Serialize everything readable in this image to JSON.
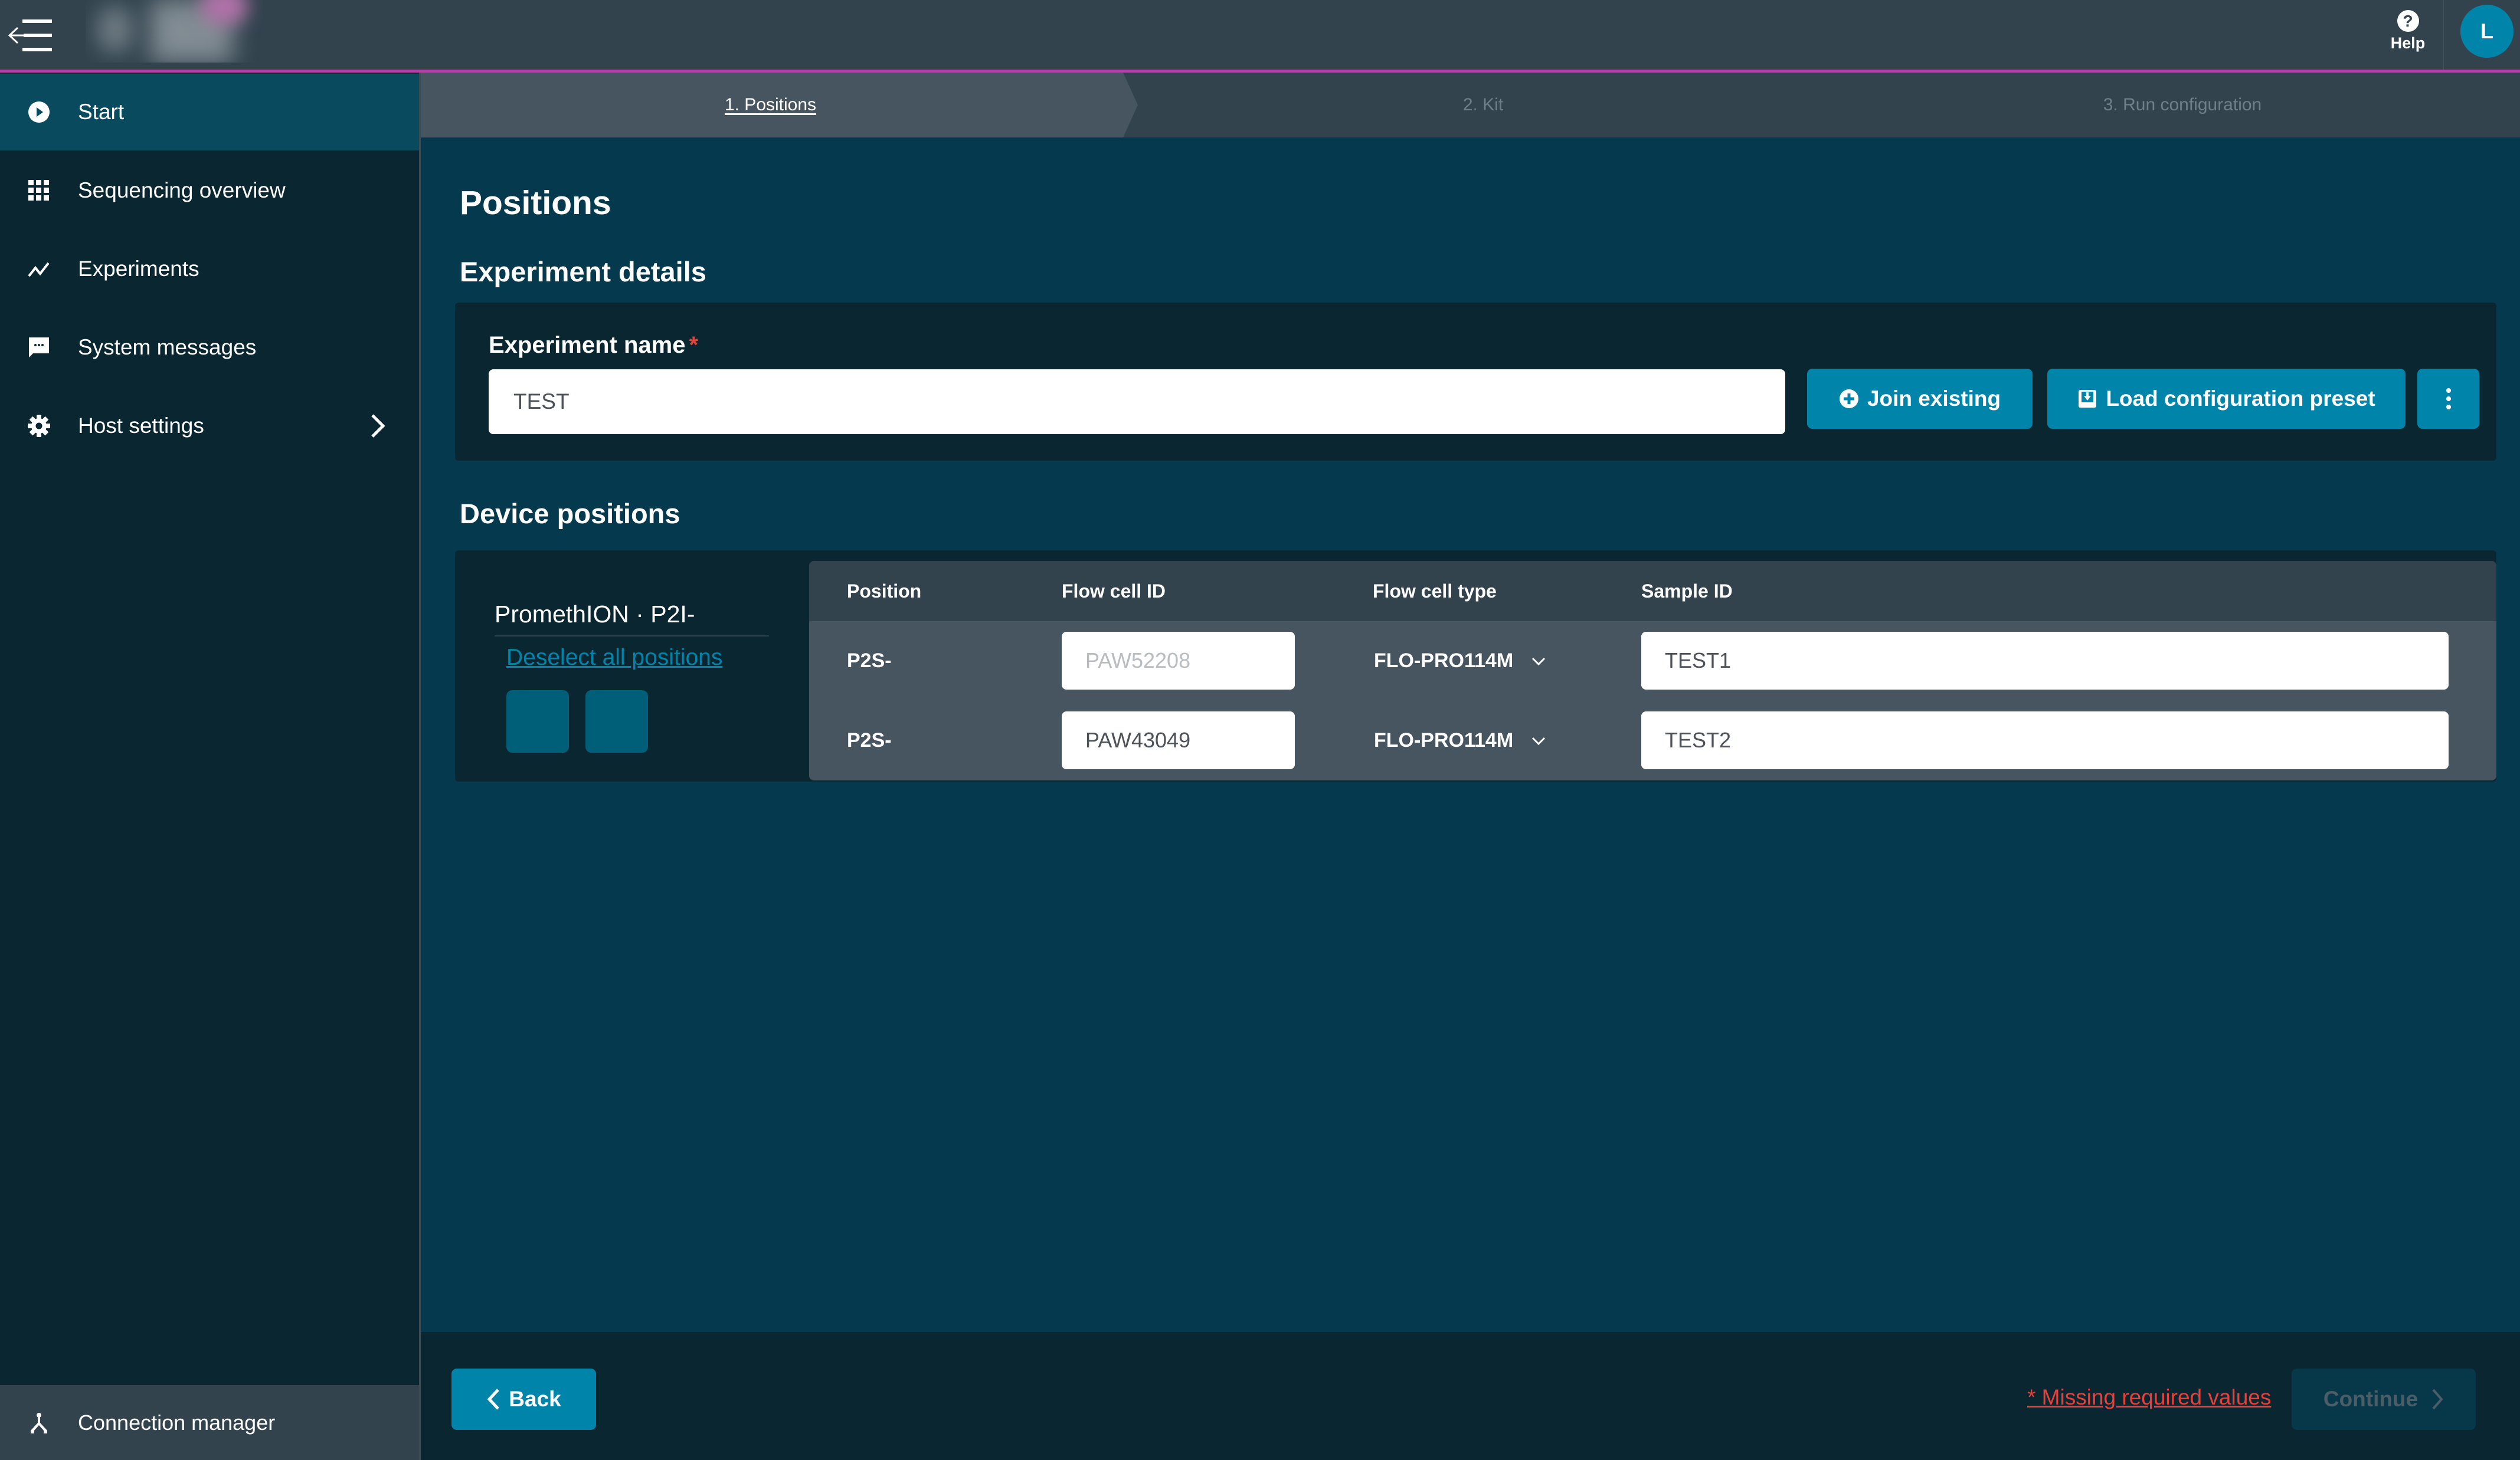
{
  "topbar": {
    "help_label": "Help",
    "help_glyph": "?",
    "avatar_initial": "L",
    "accent_line_color": "#b542a6"
  },
  "sidebar": {
    "items": [
      {
        "label": "Start",
        "icon": "play-circle-icon",
        "active": true
      },
      {
        "label": "Sequencing overview",
        "icon": "grid-icon"
      },
      {
        "label": "Experiments",
        "icon": "trend-line-icon"
      },
      {
        "label": "System messages",
        "icon": "chat-bubble-icon"
      },
      {
        "label": "Host settings",
        "icon": "gear-icon",
        "has_submenu": true
      }
    ],
    "bottom_item": {
      "label": "Connection manager",
      "icon": "network-icon"
    }
  },
  "stepper": {
    "steps": [
      {
        "label": "1. Positions",
        "active": true
      },
      {
        "label": "2. Kit",
        "active": false
      },
      {
        "label": "3. Run configuration",
        "active": false
      }
    ]
  },
  "main": {
    "page_title": "Positions",
    "experiment_details": {
      "title": "Experiment details",
      "name_label": "Experiment name",
      "required_marker": "*",
      "name_value": "TEST",
      "join_existing_label": "Join existing",
      "load_preset_label": "Load configuration preset",
      "more_options_glyph": "⋮"
    },
    "device_positions": {
      "title": "Device positions",
      "device_name": "PromethION · P2I-",
      "deselect_all_label": "Deselect all positions",
      "position_tiles": 2,
      "table": {
        "headers": [
          "Position",
          "Flow cell ID",
          "Flow cell type",
          "Sample ID"
        ],
        "rows": [
          {
            "position": "P2S-",
            "flow_cell_id": "",
            "flow_cell_id_placeholder": "PAW52208",
            "flow_cell_type": "FLO-PRO114M",
            "sample_id": "TEST1"
          },
          {
            "position": "P2S-",
            "flow_cell_id": "PAW43049",
            "flow_cell_id_placeholder": "",
            "flow_cell_type": "FLO-PRO114M",
            "sample_id": "TEST2"
          }
        ]
      }
    }
  },
  "footer": {
    "back_label": "Back",
    "missing_values_label": "* Missing required values",
    "continue_label": "Continue",
    "continue_disabled": true
  },
  "colors": {
    "primary_button": "#0084a9",
    "error": "#e8403a",
    "sidebar_bg": "#0a2630",
    "content_bg": "#05394d"
  }
}
